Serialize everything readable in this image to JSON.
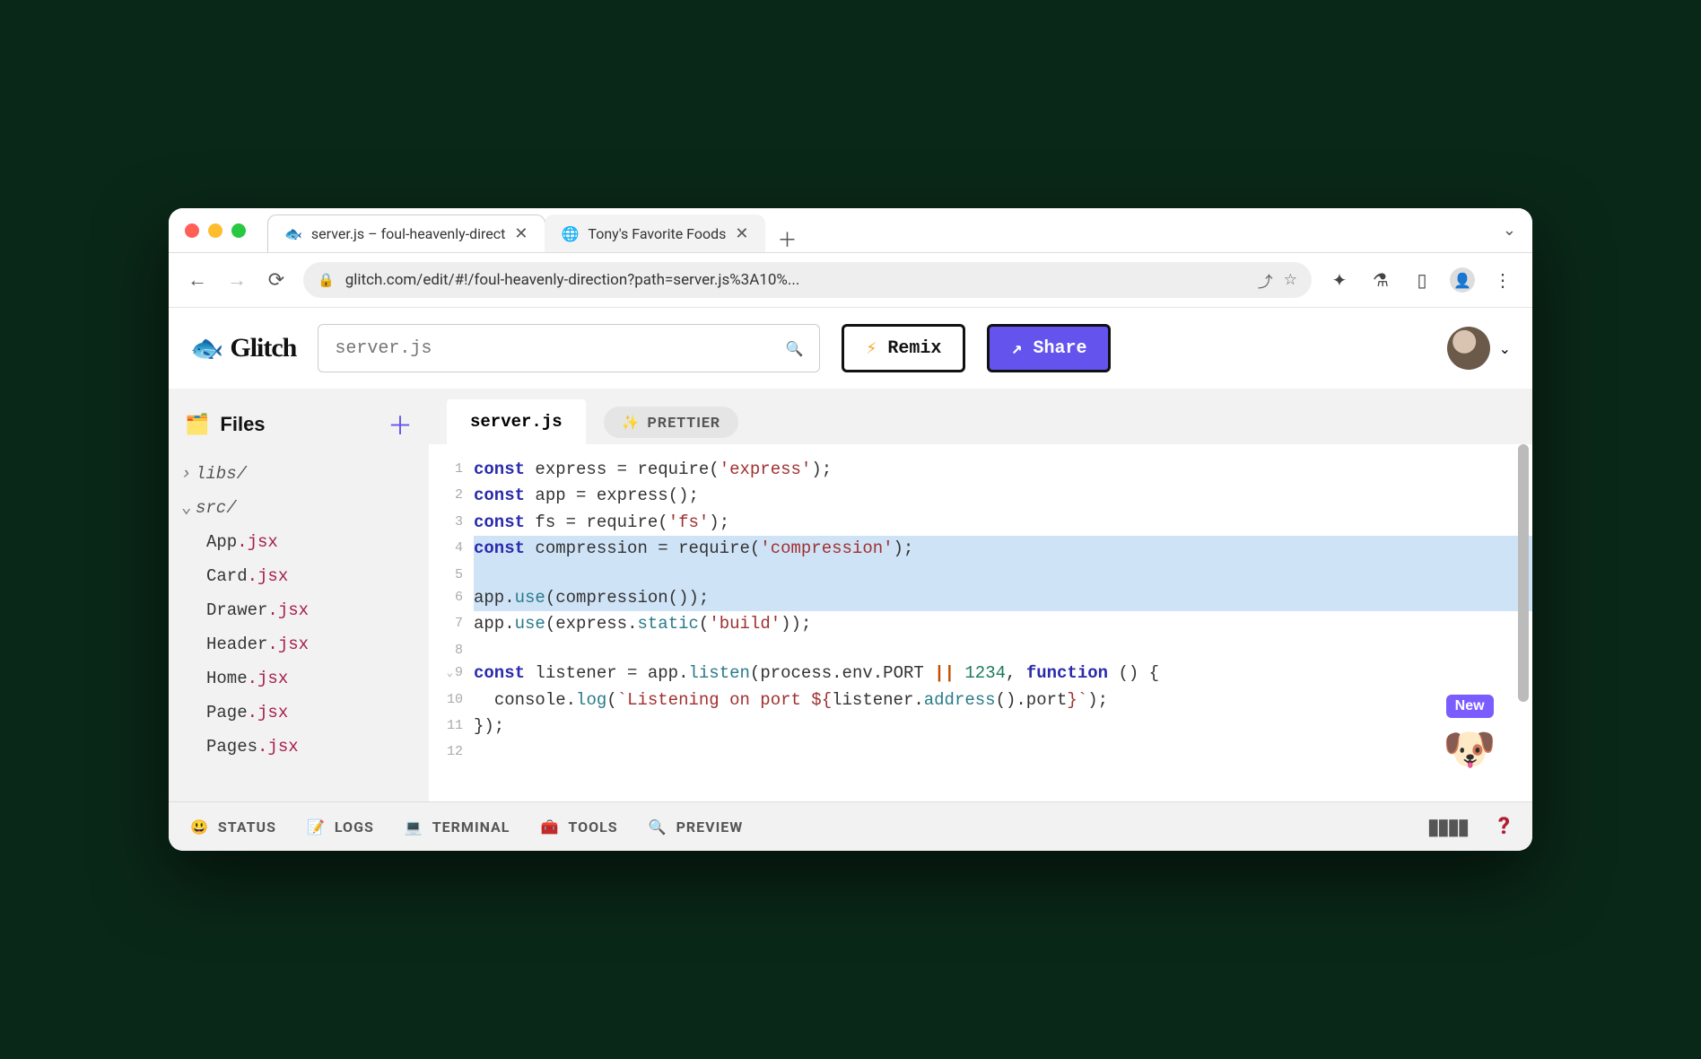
{
  "browser": {
    "tabs": [
      {
        "favicon": "🐟",
        "title": "server.js – foul-heavenly-direct",
        "active": true
      },
      {
        "favicon": "🌐",
        "title": "Tony's Favorite Foods",
        "active": false
      }
    ],
    "url": "glitch.com/edit/#!/foul-heavenly-direction?path=server.js%3A10%..."
  },
  "app": {
    "brand": "Glitch",
    "search_placeholder": "server.js",
    "remix_label": "Remix",
    "share_label": "Share"
  },
  "sidebar": {
    "heading": "Files",
    "tree": {
      "folders": [
        {
          "name": "libs/",
          "expanded": false
        },
        {
          "name": "src/",
          "expanded": true,
          "files": [
            "App.jsx",
            "Card.jsx",
            "Drawer.jsx",
            "Header.jsx",
            "Home.jsx",
            "Page.jsx",
            "Pages.jsx"
          ]
        }
      ]
    }
  },
  "editor": {
    "open_file": "server.js",
    "prettier_label": "PRETTIER",
    "highlighted_lines": [
      4,
      5,
      6
    ],
    "lines": [
      {
        "n": 1,
        "tokens": [
          [
            "kw",
            "const"
          ],
          [
            "sp",
            " "
          ],
          [
            "id",
            "express"
          ],
          [
            "sp",
            " "
          ],
          [
            "op",
            "="
          ],
          [
            "sp",
            " "
          ],
          [
            "id",
            "require"
          ],
          [
            "punc",
            "("
          ],
          [
            "str",
            "'express'"
          ],
          [
            "punc",
            ");"
          ]
        ]
      },
      {
        "n": 2,
        "tokens": [
          [
            "kw",
            "const"
          ],
          [
            "sp",
            " "
          ],
          [
            "id",
            "app"
          ],
          [
            "sp",
            " "
          ],
          [
            "op",
            "="
          ],
          [
            "sp",
            " "
          ],
          [
            "id",
            "express"
          ],
          [
            "punc",
            "();"
          ]
        ]
      },
      {
        "n": 3,
        "tokens": [
          [
            "kw",
            "const"
          ],
          [
            "sp",
            " "
          ],
          [
            "id",
            "fs"
          ],
          [
            "sp",
            " "
          ],
          [
            "op",
            "="
          ],
          [
            "sp",
            " "
          ],
          [
            "id",
            "require"
          ],
          [
            "punc",
            "("
          ],
          [
            "str",
            "'fs'"
          ],
          [
            "punc",
            ");"
          ]
        ]
      },
      {
        "n": 4,
        "tokens": [
          [
            "kw",
            "const"
          ],
          [
            "sp",
            " "
          ],
          [
            "id",
            "compression"
          ],
          [
            "sp",
            " "
          ],
          [
            "op",
            "="
          ],
          [
            "sp",
            " "
          ],
          [
            "id",
            "require"
          ],
          [
            "punc",
            "("
          ],
          [
            "str",
            "'compression'"
          ],
          [
            "punc",
            ");"
          ]
        ]
      },
      {
        "n": 5,
        "tokens": [
          [
            "sp",
            ""
          ]
        ]
      },
      {
        "n": 6,
        "tokens": [
          [
            "id",
            "app"
          ],
          [
            "punc",
            "."
          ],
          [
            "fn",
            "use"
          ],
          [
            "punc",
            "("
          ],
          [
            "id",
            "compression"
          ],
          [
            "punc",
            "());"
          ]
        ]
      },
      {
        "n": 7,
        "tokens": [
          [
            "id",
            "app"
          ],
          [
            "punc",
            "."
          ],
          [
            "fn",
            "use"
          ],
          [
            "punc",
            "("
          ],
          [
            "id",
            "express"
          ],
          [
            "punc",
            "."
          ],
          [
            "fn",
            "static"
          ],
          [
            "punc",
            "("
          ],
          [
            "str",
            "'build'"
          ],
          [
            "punc",
            "));"
          ]
        ]
      },
      {
        "n": 8,
        "tokens": [
          [
            "sp",
            ""
          ]
        ]
      },
      {
        "n": 9,
        "fold": true,
        "tokens": [
          [
            "kw",
            "const"
          ],
          [
            "sp",
            " "
          ],
          [
            "id",
            "listener"
          ],
          [
            "sp",
            " "
          ],
          [
            "op",
            "="
          ],
          [
            "sp",
            " "
          ],
          [
            "id",
            "app"
          ],
          [
            "punc",
            "."
          ],
          [
            "fn",
            "listen"
          ],
          [
            "punc",
            "("
          ],
          [
            "id",
            "process"
          ],
          [
            "punc",
            "."
          ],
          [
            "id",
            "env"
          ],
          [
            "punc",
            "."
          ],
          [
            "id",
            "PORT"
          ],
          [
            "sp",
            " "
          ],
          [
            "orop",
            "||"
          ],
          [
            "sp",
            " "
          ],
          [
            "num",
            "1234"
          ],
          [
            "punc",
            ", "
          ],
          [
            "kw",
            "function"
          ],
          [
            "sp",
            " "
          ],
          [
            "punc",
            "() {"
          ]
        ]
      },
      {
        "n": 10,
        "tokens": [
          [
            "sp",
            "  "
          ],
          [
            "id",
            "console"
          ],
          [
            "punc",
            "."
          ],
          [
            "fn",
            "log"
          ],
          [
            "punc",
            "("
          ],
          [
            "str",
            "`Listening on port ${"
          ],
          [
            "id",
            "listener"
          ],
          [
            "punc",
            "."
          ],
          [
            "fn",
            "address"
          ],
          [
            "punc",
            "()."
          ],
          [
            "id",
            "port"
          ],
          [
            "str",
            "}`"
          ],
          [
            "punc",
            ");"
          ]
        ]
      },
      {
        "n": 11,
        "tokens": [
          [
            "punc",
            "});"
          ]
        ]
      },
      {
        "n": 12,
        "tokens": [
          [
            "sp",
            ""
          ]
        ]
      }
    ],
    "new_badge": "New"
  },
  "footer": {
    "items": [
      {
        "icon": "😃",
        "label": "STATUS"
      },
      {
        "icon": "📝",
        "label": "LOGS"
      },
      {
        "icon": "💻",
        "label": "TERMINAL"
      },
      {
        "icon": "🧰",
        "label": "TOOLS"
      },
      {
        "icon": "🔍",
        "label": "PREVIEW"
      }
    ]
  }
}
